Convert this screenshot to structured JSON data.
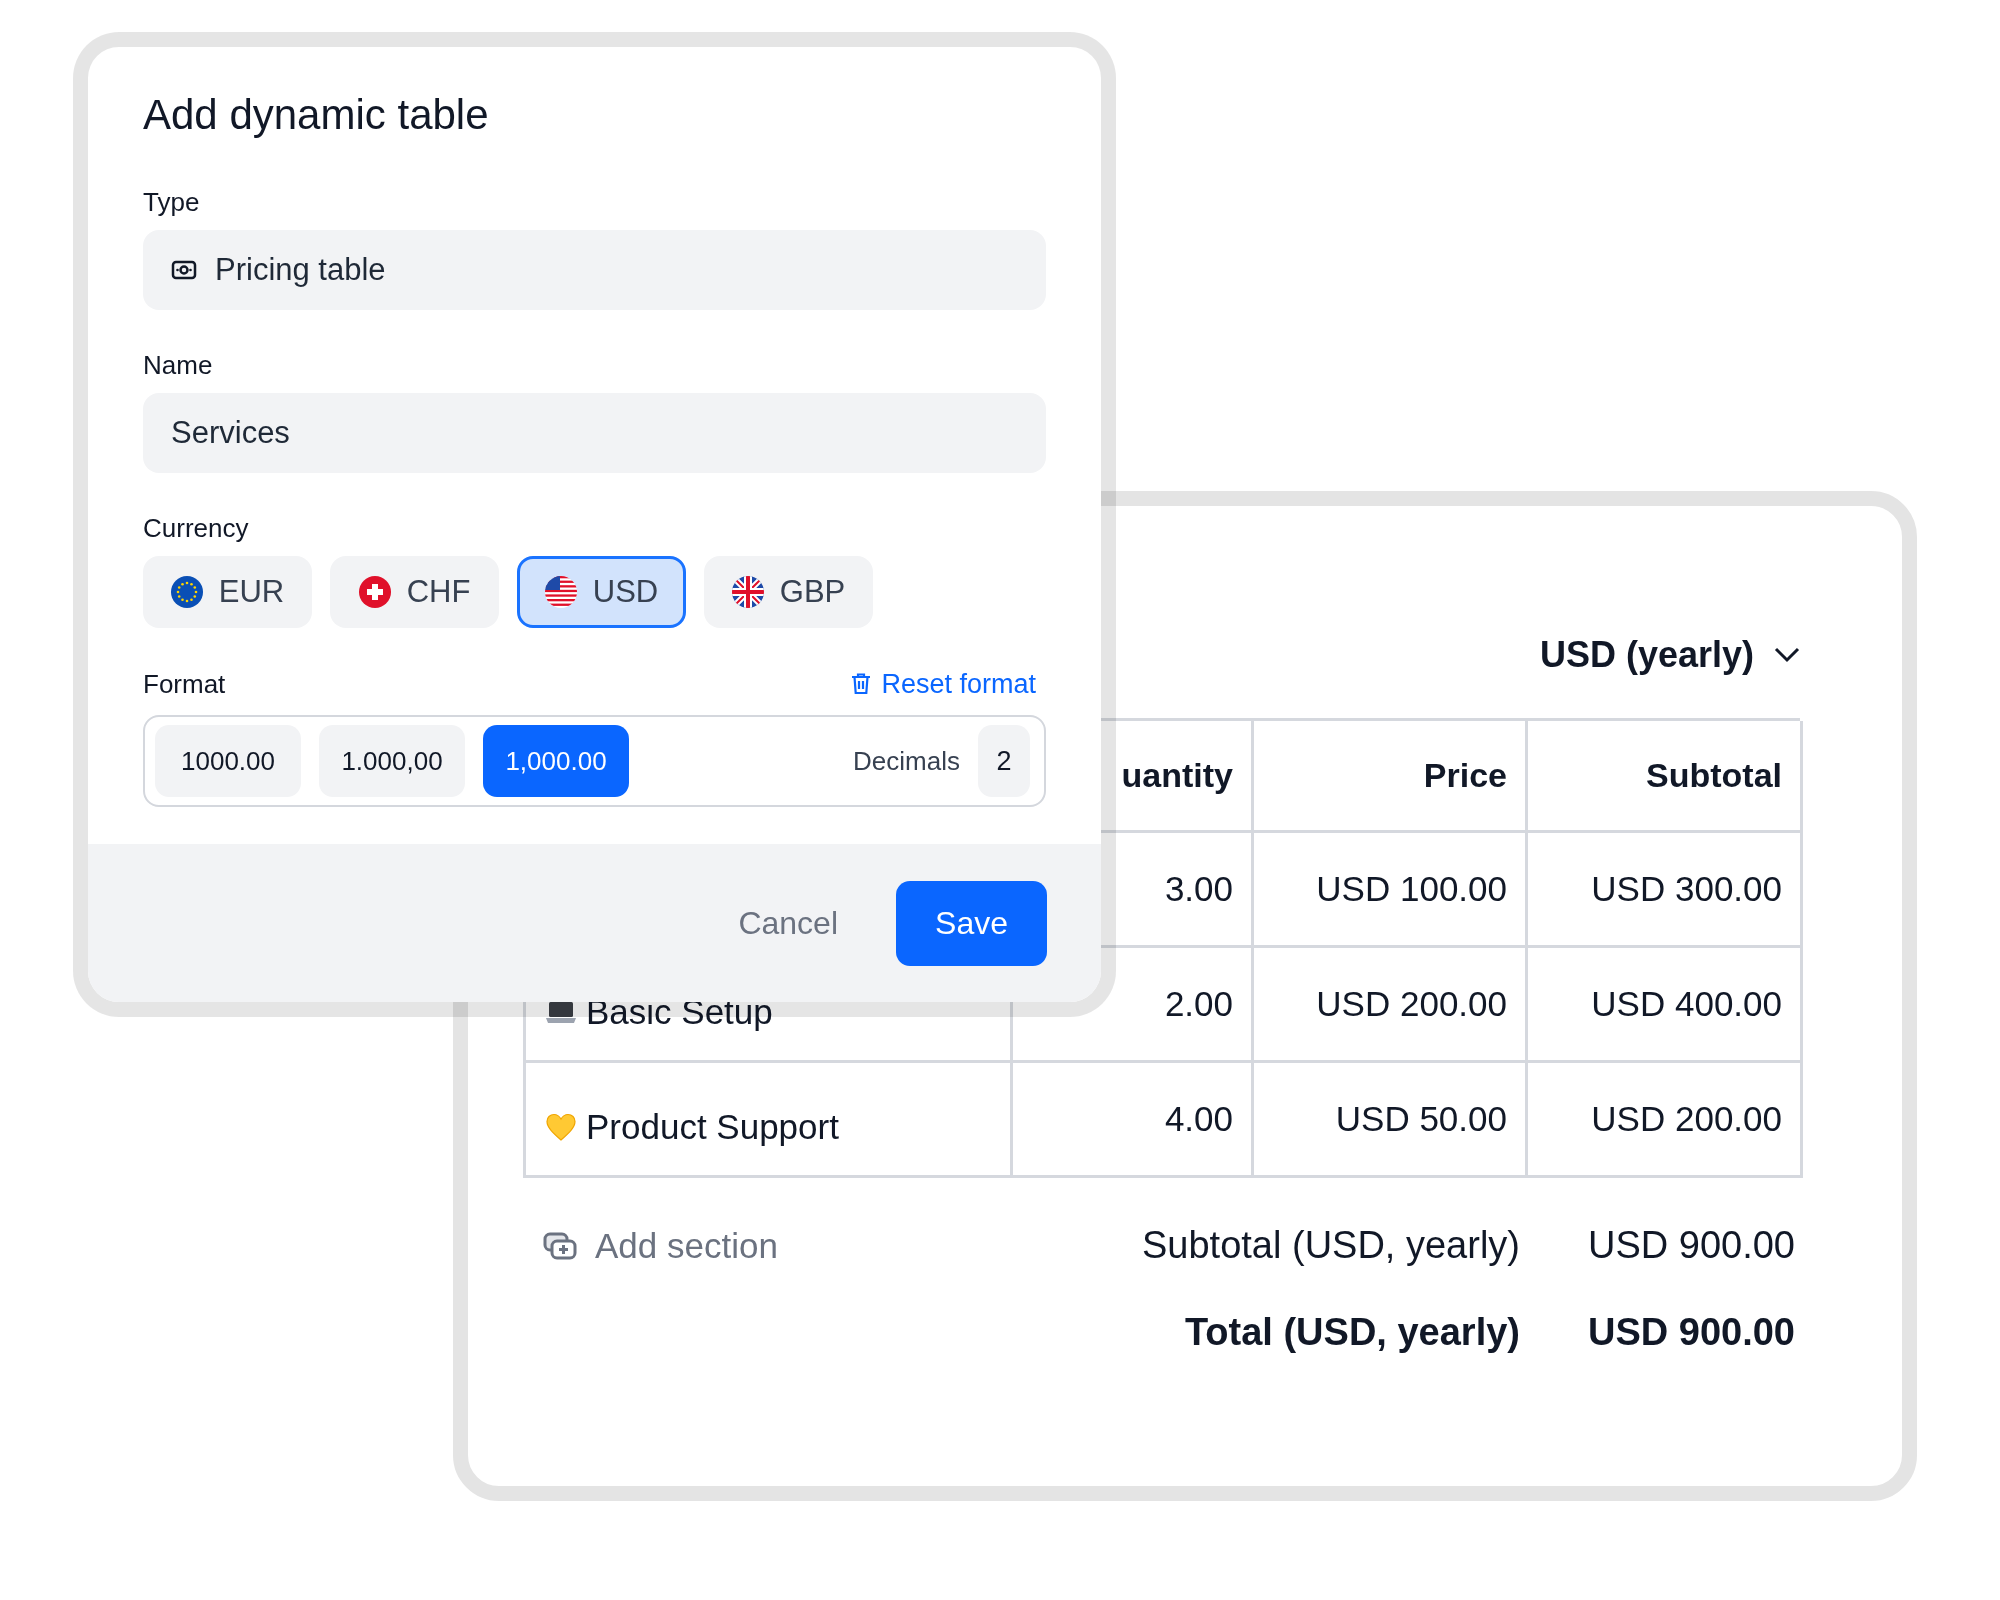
{
  "dialog": {
    "title": "Add dynamic table",
    "type": {
      "label": "Type",
      "value": "Pricing table"
    },
    "name": {
      "label": "Name",
      "value": "Services"
    },
    "currency": {
      "label": "Currency",
      "options": [
        {
          "code": "EUR",
          "selected": false
        },
        {
          "code": "CHF",
          "selected": false
        },
        {
          "code": "USD",
          "selected": true
        },
        {
          "code": "GBP",
          "selected": false
        }
      ]
    },
    "format": {
      "label": "Format",
      "reset": "Reset format",
      "options": [
        {
          "label": "1000.00",
          "selected": false
        },
        {
          "label": "1.000,00",
          "selected": false
        },
        {
          "label": "1,000.00",
          "selected": true
        }
      ],
      "decimals_label": "Decimals",
      "decimals": "2"
    },
    "buttons": {
      "cancel": "Cancel",
      "save": "Save"
    }
  },
  "table_card": {
    "period": "USD (yearly)",
    "columns": [
      "uantity",
      "Price",
      "Subtotal"
    ],
    "rows": [
      {
        "quantity": "3.00",
        "price": "USD 100.00",
        "subtotal": "USD 300.00"
      },
      {
        "name": "Basic Setup",
        "quantity": "2.00",
        "price": "USD 200.00",
        "subtotal": "USD 400.00"
      },
      {
        "name": "Product Support",
        "quantity": "4.00",
        "price": "USD 50.00",
        "subtotal": "USD 200.00"
      }
    ],
    "add_section": "Add section",
    "totals": [
      {
        "label": "Subtotal (USD, yearly)",
        "value": "USD 900.00",
        "bold": false
      },
      {
        "label": "Total (USD, yearly)",
        "value": "USD 900.00",
        "bold": true
      }
    ]
  }
}
